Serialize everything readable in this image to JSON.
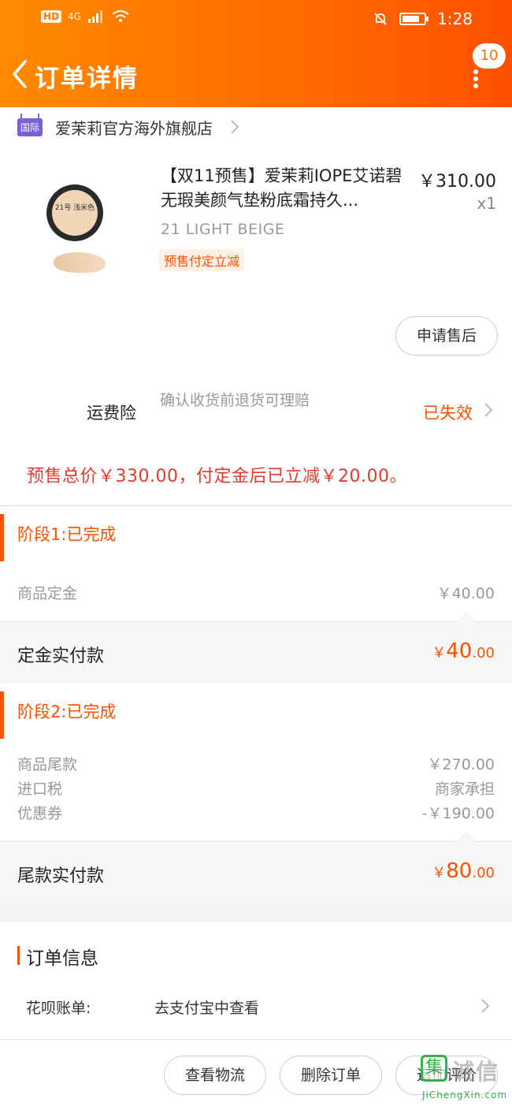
{
  "status_bar": {
    "hd": "HD",
    "network": "4G",
    "time": "1:28"
  },
  "header": {
    "title": "订单详情",
    "badge_count": "10"
  },
  "shop": {
    "tag": "国际",
    "name": "爱茉莉官方海外旗舰店"
  },
  "product": {
    "image_text": "21号 浅米色",
    "title": "【双11预售】爱茉莉IOPE艾诺碧无瑕美颜气垫粉底霜持久...",
    "price": "￥310.00",
    "quantity": "x1",
    "sku": "21 LIGHT BEIGE",
    "tag": "预售付定立减",
    "after_sale_label": "申请售后"
  },
  "insurance": {
    "label": "运费险",
    "description": "确认收货前退货可理赔",
    "status": "已失效"
  },
  "presale_note": "预售总价￥330.00，付定金后已立减￥20.00。",
  "stage1": {
    "title": "阶段1:已完成",
    "fees": [
      {
        "label": "商品定金",
        "value": "￥40.00"
      }
    ],
    "pay_label": "定金实付款",
    "pay_currency": "￥",
    "pay_int": "40",
    "pay_dec": ".00"
  },
  "stage2": {
    "title": "阶段2:已完成",
    "fees": [
      {
        "label": "商品尾款",
        "value": "￥270.00"
      },
      {
        "label": "进口税",
        "value": "商家承担"
      },
      {
        "label": "优惠券",
        "value": "-￥190.00"
      }
    ],
    "pay_label": "尾款实付款",
    "pay_currency": "￥",
    "pay_int": "80",
    "pay_dec": ".00"
  },
  "order_info": {
    "title": "订单信息",
    "huabei_label": "花呗账单:",
    "huabei_value": "去支付宝中查看"
  },
  "actions": {
    "logistics": "查看物流",
    "delete": "删除订单",
    "review": "追加评价"
  },
  "watermark": {
    "logo": "集",
    "text": "诚信",
    "url": "JiChengXin.com"
  },
  "colors": {
    "accent": "#ff5000",
    "header_start": "#ff8a00",
    "header_end": "#ff5000",
    "price_red": "#e53a2b"
  }
}
